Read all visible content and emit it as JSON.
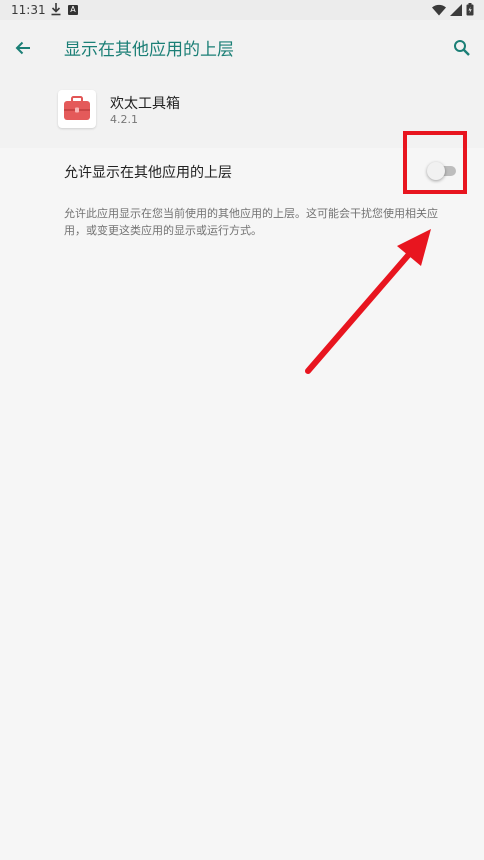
{
  "status_bar": {
    "time": "11:31",
    "icons": [
      "download-icon",
      "a-badge-icon",
      "wifi-icon",
      "signal-icon",
      "battery-icon"
    ],
    "badge_text": "A"
  },
  "toolbar": {
    "title": "显示在其他应用的上层",
    "accent_color": "#1b7f76"
  },
  "app": {
    "name": "欢太工具箱",
    "version": "4.2.1"
  },
  "setting": {
    "label": "允许显示在其他应用的上层",
    "enabled": false
  },
  "description": "允许此应用显示在您当前使用的其他应用的上层。这可能会干扰您使用相关应用，或变更这类应用的显示或运行方式。",
  "annotation": {
    "color": "#e8151f"
  }
}
